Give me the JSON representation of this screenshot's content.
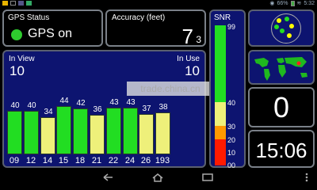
{
  "status_bar": {
    "battery": "66%",
    "time": "5:32"
  },
  "gps_status": {
    "label": "GPS Status",
    "value": "GPS on",
    "dot_color": "#2ecc2e"
  },
  "accuracy": {
    "label": "Accuracy (feet)",
    "value": "7",
    "sub": "3"
  },
  "satellites": {
    "in_view_label": "In View",
    "in_view_value": "10",
    "in_use_label": "In Use",
    "in_use_value": "10"
  },
  "chart_data": {
    "type": "bar",
    "categories": [
      "09",
      "12",
      "14",
      "15",
      "18",
      "21",
      "22",
      "24",
      "26",
      "193"
    ],
    "values": [
      40,
      40,
      34,
      44,
      42,
      36,
      43,
      43,
      37,
      38
    ],
    "value_labels": [
      "40",
      "40",
      "34",
      "44",
      "42",
      "36",
      "43",
      "43",
      "37",
      "38"
    ],
    "ylim": [
      0,
      55
    ]
  },
  "snr": {
    "label": "SNR",
    "ticks": [
      "99",
      "40",
      "30",
      "20",
      "10",
      "00"
    ],
    "colors": {
      "green": "#22dd22",
      "yellow": "#eef07a",
      "orange": "#ff9900",
      "red": "#ff1a00"
    }
  },
  "watermark": "trade.china.cn",
  "speed": {
    "value": "0"
  },
  "clock": {
    "value": "15:06"
  }
}
